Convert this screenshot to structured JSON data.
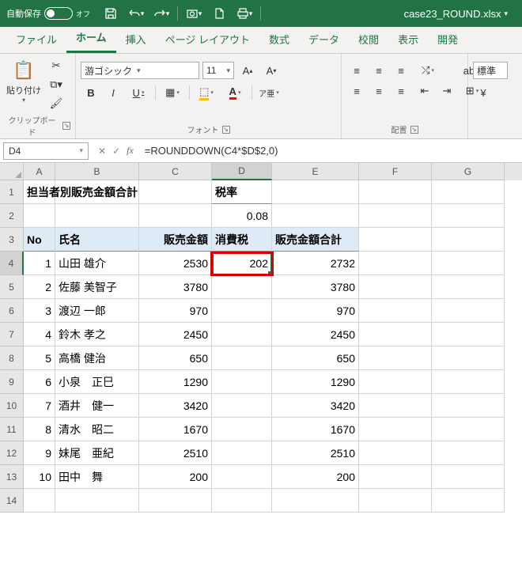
{
  "titlebar": {
    "autosave_label": "自動保存",
    "autosave_state": "オフ",
    "filename": "case23_ROUND.xlsx"
  },
  "tabs": {
    "file": "ファイル",
    "home": "ホーム",
    "insert": "挿入",
    "pagelayout": "ページ レイアウト",
    "formulas": "数式",
    "data": "データ",
    "review": "校閲",
    "view": "表示",
    "developer": "開発"
  },
  "ribbon": {
    "clipboard": {
      "paste": "貼り付け",
      "group_label": "クリップボード"
    },
    "font": {
      "name": "游ゴシック",
      "size": "11",
      "group_label": "フォント",
      "bold": "B",
      "italic": "I",
      "underline": "U"
    },
    "alignment": {
      "group_label": "配置",
      "wrap": "折",
      "merge": "セ",
      "std": "標準"
    }
  },
  "formulabar": {
    "namebox": "D4",
    "formula": "=ROUNDDOWN(C4*$D$2,0)"
  },
  "columns": [
    "A",
    "B",
    "C",
    "D",
    "E",
    "F",
    "G"
  ],
  "sheet": {
    "r1": {
      "A": "担当者別販売金額合計",
      "D": "税率"
    },
    "r2": {
      "D": "0.08"
    },
    "r3": {
      "A": "No",
      "B": "氏名",
      "C": "販売金額",
      "D": "消費税",
      "E": "販売金額合計"
    },
    "rows": [
      {
        "no": "1",
        "name": "山田 雄介",
        "sales": "2530",
        "tax": "202",
        "total": "2732"
      },
      {
        "no": "2",
        "name": "佐藤 美智子",
        "sales": "3780",
        "tax": "",
        "total": "3780"
      },
      {
        "no": "3",
        "name": "渡辺 一郎",
        "sales": "970",
        "tax": "",
        "total": "970"
      },
      {
        "no": "4",
        "name": "鈴木 孝之",
        "sales": "2450",
        "tax": "",
        "total": "2450"
      },
      {
        "no": "5",
        "name": "高橋 健治",
        "sales": "650",
        "tax": "",
        "total": "650"
      },
      {
        "no": "6",
        "name": "小泉　正巳",
        "sales": "1290",
        "tax": "",
        "total": "1290"
      },
      {
        "no": "7",
        "name": "酒井　健一",
        "sales": "3420",
        "tax": "",
        "total": "3420"
      },
      {
        "no": "8",
        "name": "清水　昭二",
        "sales": "1670",
        "tax": "",
        "total": "1670"
      },
      {
        "no": "9",
        "name": "妹尾　亜紀",
        "sales": "2510",
        "tax": "",
        "total": "2510"
      },
      {
        "no": "10",
        "name": "田中　舞",
        "sales": "200",
        "tax": "",
        "total": "200"
      }
    ]
  }
}
